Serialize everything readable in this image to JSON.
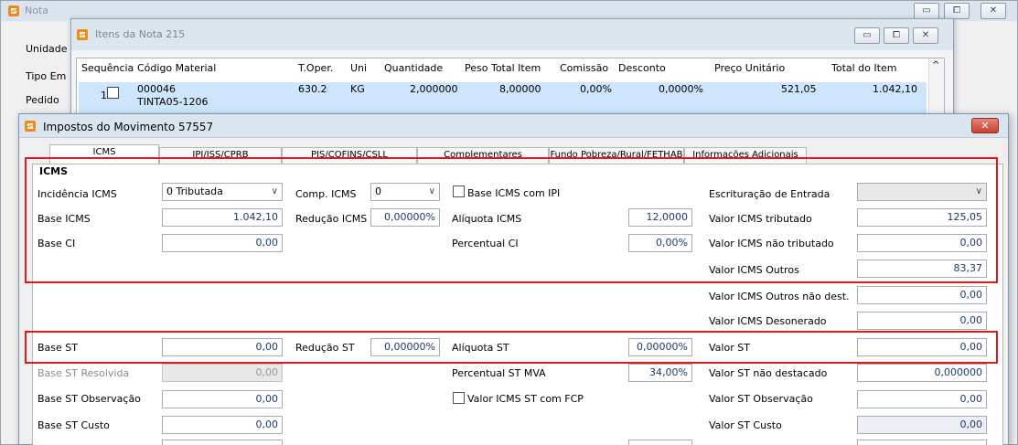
{
  "back_window": {
    "title": "Nota",
    "labels": [
      "Unidade",
      "Tipo Em",
      "Pedido"
    ]
  },
  "items_window": {
    "title": "Itens da Nota 215",
    "columns": [
      "Sequência",
      "Código Material",
      "T.Oper.",
      "Uni",
      "Quantidade",
      "Peso Total Item",
      "Comissão",
      "Desconto",
      "Preço Unitário",
      "Total do Item"
    ],
    "row": {
      "seq": "1",
      "code": "000046",
      "code_sub": "TINTA05-1206",
      "toper": "630.2",
      "uni": "KG",
      "quantidade": "2,000000",
      "peso": "8,00000",
      "comissao": "0,00%",
      "desconto": "0,0000%",
      "preco": "521,05",
      "total": "1.042,10"
    }
  },
  "imp_window": {
    "title": "Impostos do Movimento 57557",
    "close": "✕",
    "tabs": [
      "ICMS",
      "IPI/ISS/CPRB",
      "PIS/COFINS/CSLL",
      "Complementares",
      "Fundo Pobreza/Rural/FETHAB",
      "Informações Adicionais"
    ],
    "group": "ICMS",
    "incidencia_label": "Incidência ICMS",
    "incidencia_value": "0 Tributada",
    "comp_label": "Comp. ICMS",
    "comp_value": "0",
    "base_icms_ipi_label": "Base ICMS com IPI",
    "escrituracao_label": "Escrituração de Entrada",
    "base_icms_label": "Base ICMS",
    "base_icms_value": "1.042,10",
    "reducao_icms_label": "Redução ICMS",
    "reducao_icms_value": "0,00000%",
    "aliquota_icms_label": "Alíquota ICMS",
    "aliquota_icms_value": "12,0000",
    "valor_icms_trib_label": "Valor ICMS tributado",
    "valor_icms_trib_value": "125,05",
    "base_ci_label": "Base CI",
    "base_ci_value": "0,00",
    "percentual_ci_label": "Percentual CI",
    "percentual_ci_value": "0,00%",
    "valor_icms_nao_trib_label": "Valor ICMS não tributado",
    "valor_icms_nao_trib_value": "0,00",
    "valor_icms_outros_label": "Valor ICMS Outros",
    "valor_icms_outros_value": "83,37",
    "valor_icms_outros_nd_label": "Valor ICMS Outros não dest.",
    "valor_icms_outros_nd_value": "0,00",
    "valor_icms_deson_label": "Valor ICMS Desonerado",
    "valor_icms_deson_value": "0,00",
    "base_st_label": "Base ST",
    "base_st_value": "0,00",
    "reducao_st_label": "Redução ST",
    "reducao_st_value": "0,00000%",
    "aliquota_st_label": "Alíquota ST",
    "aliquota_st_value": "0,00000%",
    "valor_st_label": "Valor ST",
    "valor_st_value": "0,00",
    "base_st_resolvida_label": "Base ST Resolvida",
    "base_st_resolvida_value": "0,00",
    "percentual_st_mva_label": "Percentual ST MVA",
    "percentual_st_mva_value": "34,00%",
    "valor_st_nao_dest_label": "Valor ST não destacado",
    "valor_st_nao_dest_value": "0,000000",
    "base_st_obs_label": "Base ST Observação",
    "base_st_obs_value": "0,00",
    "valor_icms_st_fcp_label": "Valor ICMS ST com FCP",
    "valor_st_obs_label": "Valor ST Observação",
    "valor_st_obs_value": "0,00",
    "base_st_custo_label": "Base ST Custo",
    "base_st_custo_value": "0,00",
    "valor_st_custo_label": "Valor ST Custo",
    "valor_st_custo_value": "0,00"
  }
}
